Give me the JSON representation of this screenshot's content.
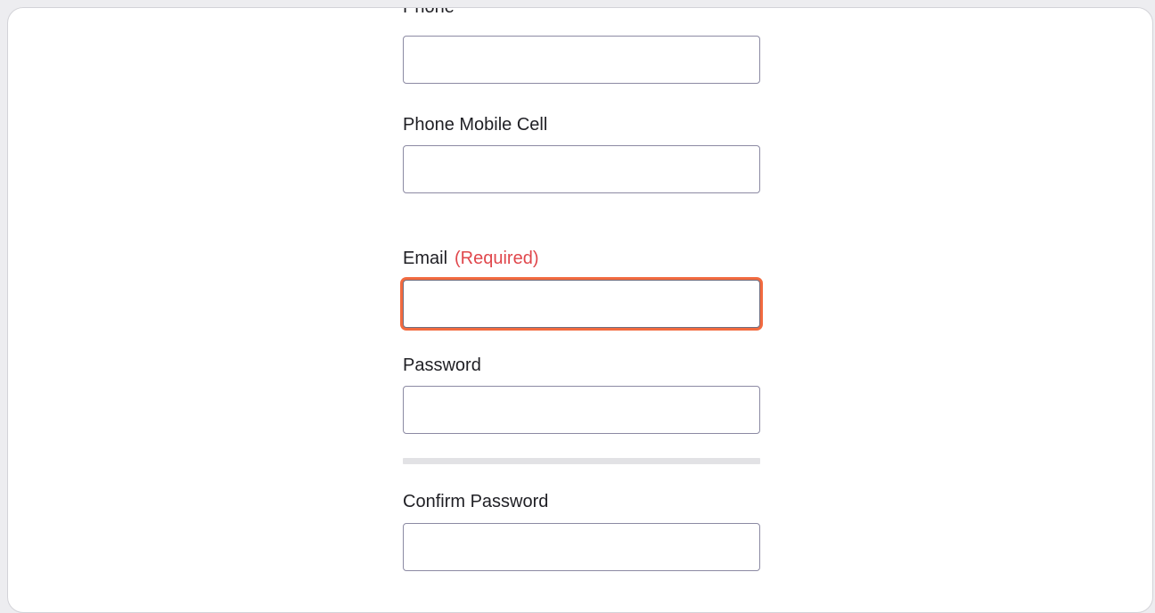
{
  "form": {
    "phone": {
      "label": "Phone",
      "value": ""
    },
    "phone_mobile_cell": {
      "label": "Phone Mobile Cell",
      "value": ""
    },
    "email": {
      "label": "Email",
      "required_text": "(Required)",
      "value": ""
    },
    "password": {
      "label": "Password",
      "value": ""
    },
    "password_strength": 0,
    "confirm_password": {
      "label": "Confirm Password",
      "value": ""
    }
  },
  "colors": {
    "required": "#e0474c",
    "focus_ring": "#f26a3f",
    "input_border": "#8c8aa3"
  }
}
